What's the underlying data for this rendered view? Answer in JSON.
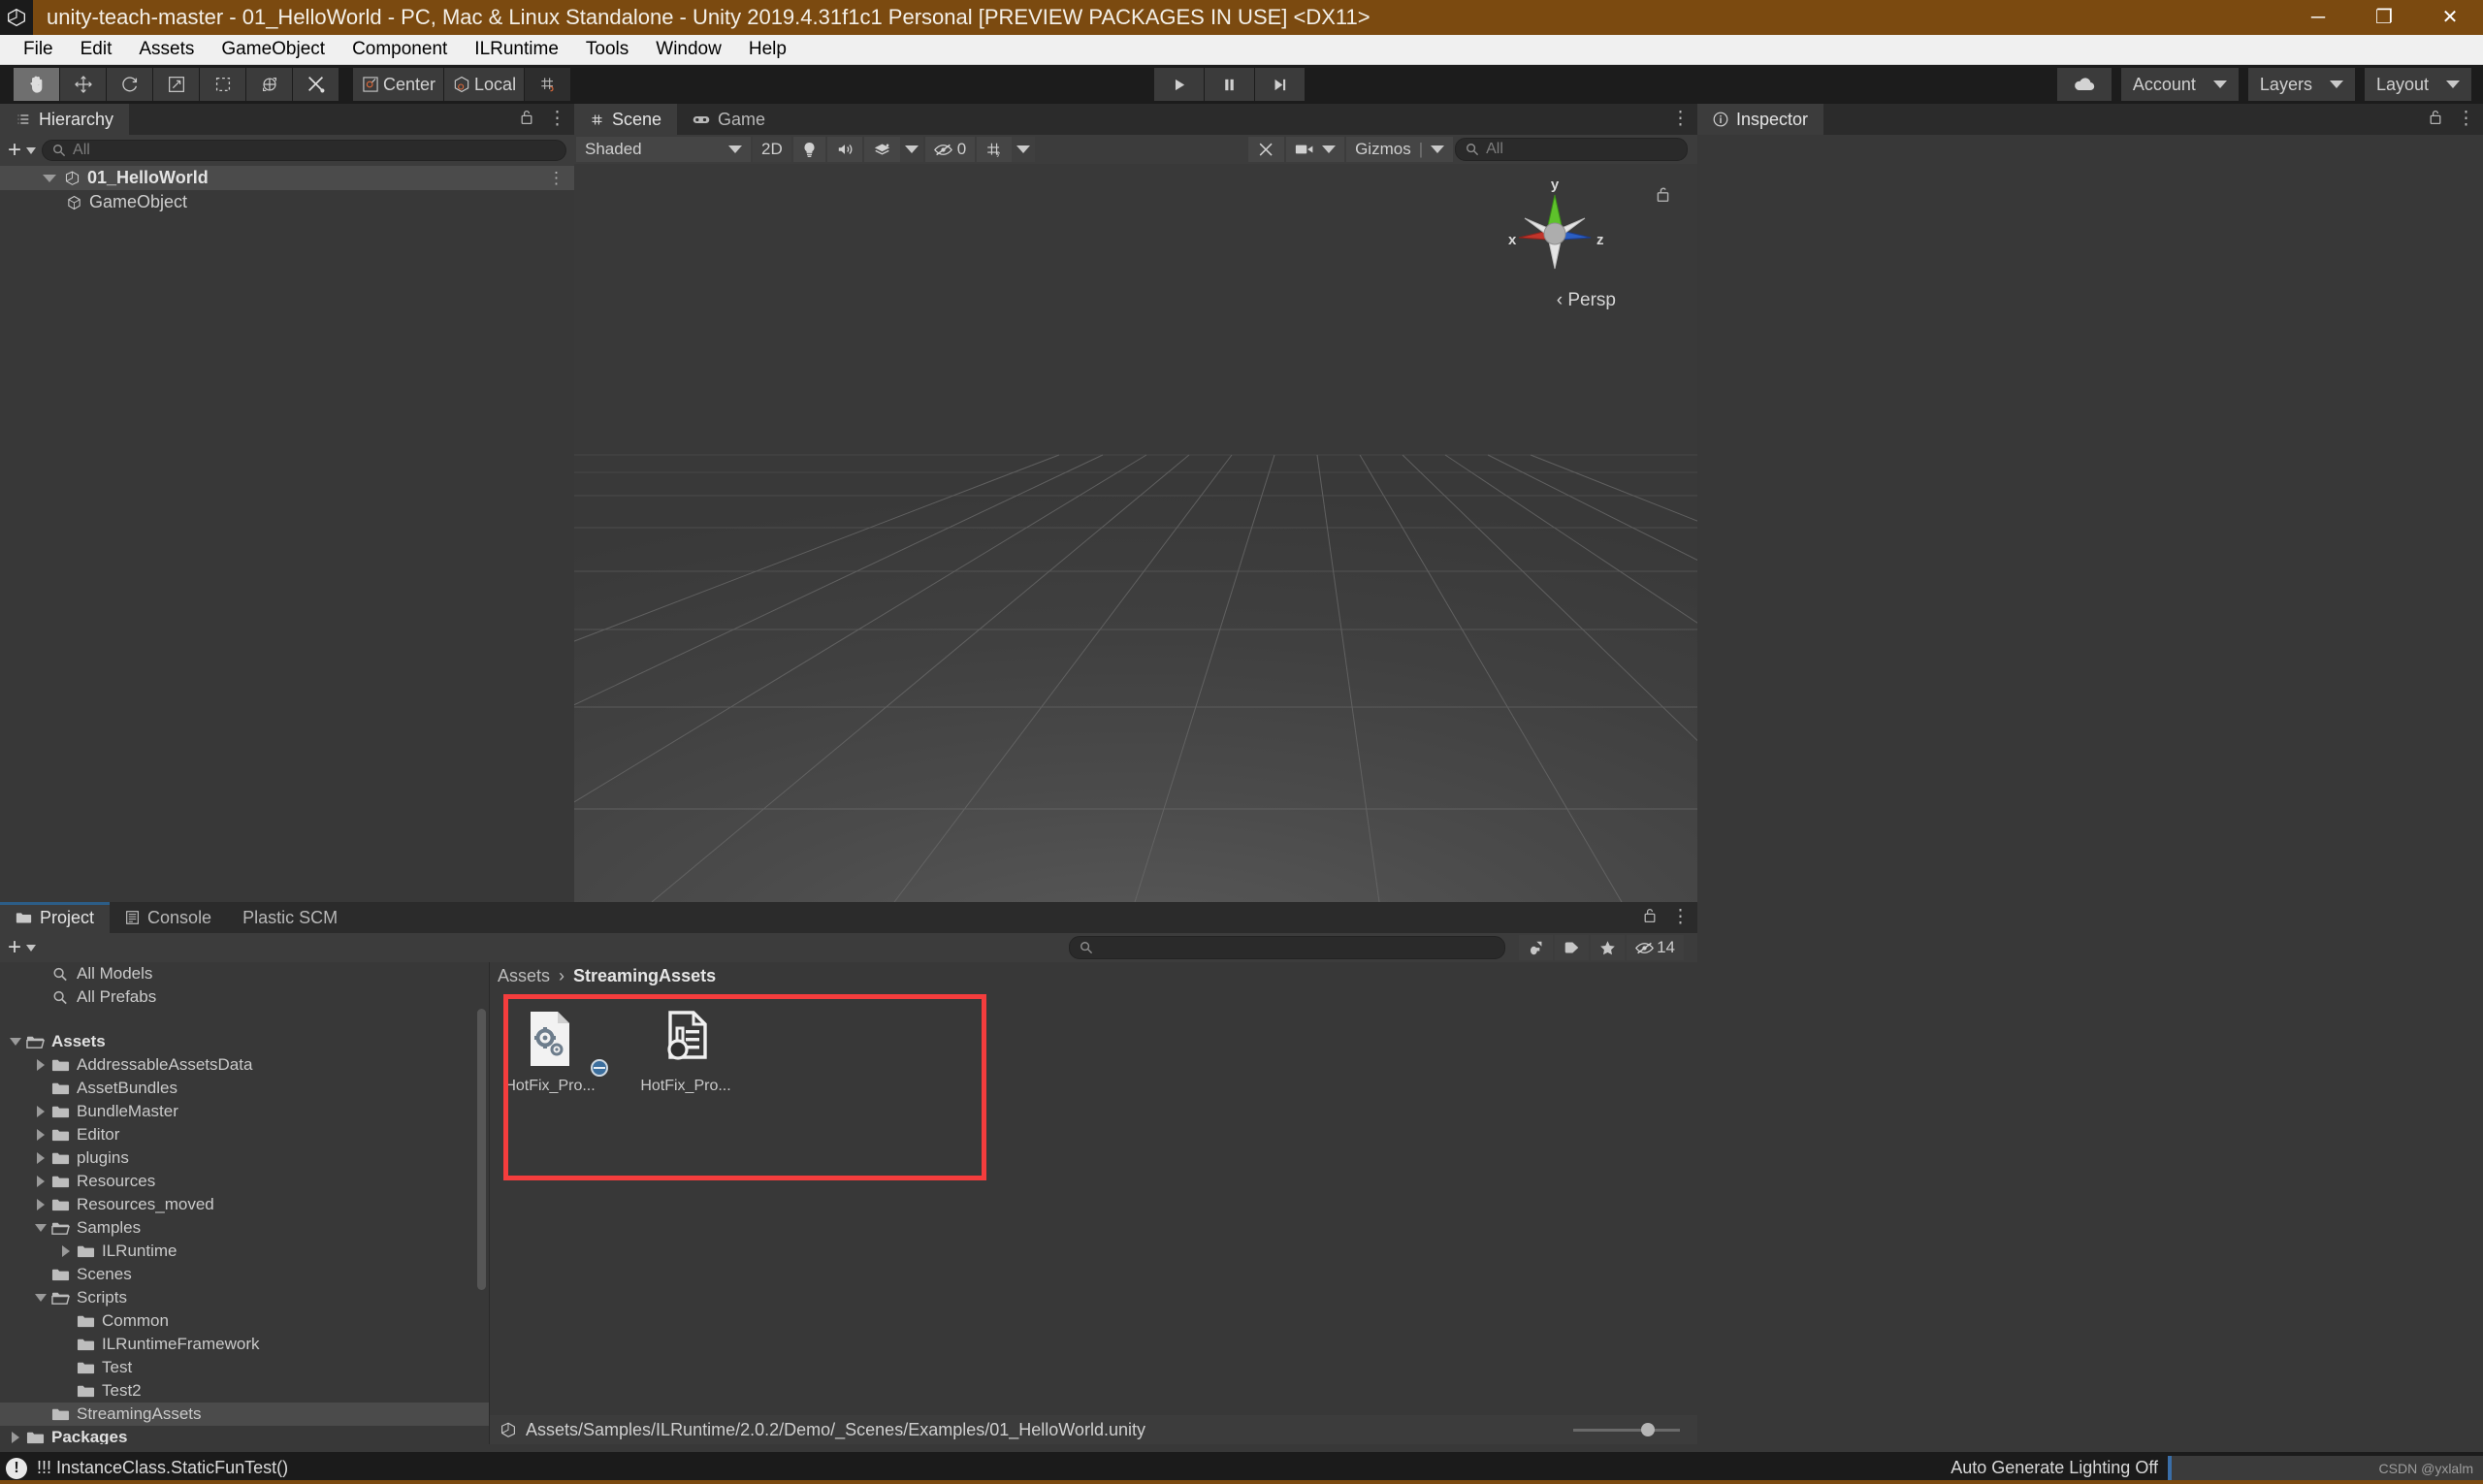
{
  "window": {
    "title": "unity-teach-master - 01_HelloWorld - PC, Mac & Linux Standalone - Unity 2019.4.31f1c1 Personal [PREVIEW PACKAGES IN USE] <DX11>",
    "minimize": "─",
    "maximize": "❐",
    "close": "✕"
  },
  "menu": {
    "items": [
      {
        "label": "File"
      },
      {
        "label": "Edit"
      },
      {
        "label": "Assets"
      },
      {
        "label": "GameObject"
      },
      {
        "label": "Component"
      },
      {
        "label": "ILRuntime"
      },
      {
        "label": "Tools"
      },
      {
        "label": "Window"
      },
      {
        "label": "Help"
      }
    ]
  },
  "toolbar": {
    "tools": [
      {
        "name": "hand-tool",
        "active": true
      },
      {
        "name": "move-tool",
        "active": false
      },
      {
        "name": "rotate-tool",
        "active": false
      },
      {
        "name": "scale-tool",
        "active": false
      },
      {
        "name": "rect-tool",
        "active": false
      },
      {
        "name": "transform-tool",
        "active": false
      },
      {
        "name": "custom-tool",
        "active": false
      }
    ],
    "pivot_label": "Center",
    "handle_label": "Local",
    "snap_label": "",
    "play": "▶",
    "pause": "❚❚",
    "step": "▶|",
    "cloud_label": "",
    "account_label": "Account",
    "layers_label": "Layers",
    "layout_label": "Layout"
  },
  "hierarchy": {
    "tab_label": "Hierarchy",
    "search_placeholder": "All",
    "create_label": "+",
    "rows": [
      {
        "label": "01_HelloWorld",
        "depth": 0,
        "bold": true,
        "selected": true,
        "expandable": true,
        "icon": "unity-scene-icon"
      },
      {
        "label": "GameObject",
        "depth": 1,
        "bold": false,
        "selected": false,
        "expandable": false,
        "icon": "cube-icon"
      }
    ]
  },
  "scene": {
    "tabs": [
      {
        "label": "Scene",
        "active": true,
        "icon": "grid-icon"
      },
      {
        "label": "Game",
        "active": false,
        "icon": "gamepad-icon"
      }
    ],
    "shading_mode": "Shaded",
    "mode_2d": "2D",
    "hidden_count": "0",
    "gizmos_label": "Gizmos",
    "search_placeholder": "All",
    "gizmo_axes": {
      "x": "x",
      "y": "y",
      "z": "z"
    },
    "projection_label": "‹ Persp"
  },
  "inspector": {
    "tab_label": "Inspector"
  },
  "project": {
    "tabs": [
      {
        "label": "Project",
        "active": true,
        "icon": "folder-icon"
      },
      {
        "label": "Console",
        "active": false,
        "icon": "console-icon"
      },
      {
        "label": "Plastic SCM",
        "active": false,
        "icon": ""
      }
    ],
    "create_label": "+",
    "search_placeholder": "",
    "hidden_packages_count": "14",
    "breadcrumb": {
      "root": "Assets",
      "separator": "›",
      "current": "StreamingAssets"
    },
    "tree": [
      {
        "label": "All Models",
        "depth": 1,
        "twirl": "none",
        "icon": "search-icon",
        "bold": false,
        "selected": false
      },
      {
        "label": "All Prefabs",
        "depth": 1,
        "twirl": "none",
        "icon": "search-icon",
        "bold": false,
        "selected": false
      },
      {
        "label": "",
        "depth": 0,
        "twirl": "none",
        "icon": "spacer",
        "bold": false,
        "selected": false
      },
      {
        "label": "Assets",
        "depth": 0,
        "twirl": "open",
        "icon": "folder-open-icon",
        "bold": true,
        "selected": false
      },
      {
        "label": "AddressableAssetsData",
        "depth": 1,
        "twirl": "closed",
        "icon": "folder-icon",
        "bold": false,
        "selected": false
      },
      {
        "label": "AssetBundles",
        "depth": 1,
        "twirl": "none",
        "icon": "folder-icon",
        "bold": false,
        "selected": false
      },
      {
        "label": "BundleMaster",
        "depth": 1,
        "twirl": "closed",
        "icon": "folder-icon",
        "bold": false,
        "selected": false
      },
      {
        "label": "Editor",
        "depth": 1,
        "twirl": "closed",
        "icon": "folder-icon",
        "bold": false,
        "selected": false
      },
      {
        "label": "plugins",
        "depth": 1,
        "twirl": "closed",
        "icon": "folder-icon",
        "bold": false,
        "selected": false
      },
      {
        "label": "Resources",
        "depth": 1,
        "twirl": "closed",
        "icon": "folder-icon",
        "bold": false,
        "selected": false
      },
      {
        "label": "Resources_moved",
        "depth": 1,
        "twirl": "closed",
        "icon": "folder-icon",
        "bold": false,
        "selected": false
      },
      {
        "label": "Samples",
        "depth": 1,
        "twirl": "open",
        "icon": "folder-open-icon",
        "bold": false,
        "selected": false
      },
      {
        "label": "ILRuntime",
        "depth": 2,
        "twirl": "closed",
        "icon": "folder-icon",
        "bold": false,
        "selected": false
      },
      {
        "label": "Scenes",
        "depth": 1,
        "twirl": "none",
        "icon": "folder-icon",
        "bold": false,
        "selected": false
      },
      {
        "label": "Scripts",
        "depth": 1,
        "twirl": "open",
        "icon": "folder-open-icon",
        "bold": false,
        "selected": false
      },
      {
        "label": "Common",
        "depth": 2,
        "twirl": "none",
        "icon": "folder-icon",
        "bold": false,
        "selected": false
      },
      {
        "label": "ILRuntimeFramework",
        "depth": 2,
        "twirl": "none",
        "icon": "folder-icon",
        "bold": false,
        "selected": false
      },
      {
        "label": "Test",
        "depth": 2,
        "twirl": "none",
        "icon": "folder-icon",
        "bold": false,
        "selected": false
      },
      {
        "label": "Test2",
        "depth": 2,
        "twirl": "none",
        "icon": "folder-icon",
        "bold": false,
        "selected": false
      },
      {
        "label": "StreamingAssets",
        "depth": 1,
        "twirl": "none",
        "icon": "folder-icon",
        "bold": false,
        "selected": true
      },
      {
        "label": "Packages",
        "depth": 0,
        "twirl": "closed",
        "icon": "folder-icon",
        "bold": true,
        "selected": false
      }
    ],
    "assets": [
      {
        "label": "HotFix_Pro...",
        "icon": "dll-settings-icon"
      },
      {
        "label": "HotFix_Pro...",
        "icon": "binary-asset-icon"
      }
    ],
    "selected_scene_path": "Assets/Samples/ILRuntime/2.0.2/Demo/_Scenes/Examples/01_HelloWorld.unity"
  },
  "statusbar": {
    "console_message": "!!! InstanceClass.StaticFunTest()",
    "lighting_label": "Auto Generate Lighting Off",
    "watermark": "CSDN @yxlalm"
  },
  "colors": {
    "title_bar": "#7b4a10",
    "panel_bg": "#383838",
    "panel_dark": "#2b2b2b",
    "accent_red_box": "#f43d3d",
    "tab_accent": "#2c5d87",
    "axis_x": "#c1352b",
    "axis_y": "#5ec22b",
    "axis_z": "#2b5ec2"
  }
}
